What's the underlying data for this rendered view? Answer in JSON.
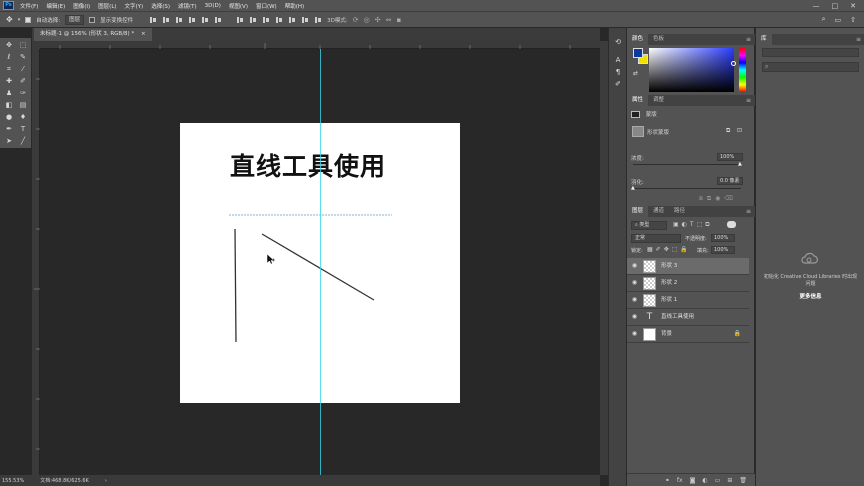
{
  "menubar": {
    "logo": "Ps",
    "items": [
      "文件(F)",
      "编辑(E)",
      "图像(I)",
      "图层(L)",
      "文字(Y)",
      "选择(S)",
      "滤镜(T)",
      "3D(D)",
      "视图(V)",
      "窗口(W)",
      "帮助(H)"
    ],
    "window_controls": [
      "—",
      "□",
      "✕"
    ]
  },
  "options": {
    "auto_select_label": "自动选择:",
    "auto_select_value": "图层",
    "transform_label": "显示变换控件"
  },
  "document": {
    "tab_title": "未标题-1 @ 156% (形状 3, RGB/8) *",
    "tab_close": "×",
    "artboard_title": "直线工具使用"
  },
  "status": {
    "zoom": "155.53%",
    "doc_size": "文档:468.8K/625.6K",
    "arrow": "›"
  },
  "color_panel": {
    "tabs": [
      "颜色",
      "色板"
    ],
    "foreground": "#0a3aa0",
    "background": "#f0e000"
  },
  "properties_panel": {
    "tabs": [
      "属性",
      "调整"
    ],
    "mask_label": "蒙版",
    "shape_mask_label": "形状蒙版",
    "density_label": "浓度:",
    "density_value": "100%",
    "feather_label": "羽化:",
    "feather_value": "0.0 像素"
  },
  "layers_panel": {
    "tabs": [
      "图层",
      "通道",
      "路径"
    ],
    "filter_kind": "类型",
    "blend_mode": "正常",
    "opacity_label": "不透明度:",
    "opacity_value": "100%",
    "lock_label": "锁定:",
    "fill_label": "填充:",
    "fill_value": "100%",
    "layers": [
      {
        "name": "形状 3",
        "type": "shape",
        "selected": true
      },
      {
        "name": "形状 2",
        "type": "shape",
        "selected": false
      },
      {
        "name": "形状 1",
        "type": "shape",
        "selected": false
      },
      {
        "name": "直线工具使用",
        "type": "text",
        "selected": false
      },
      {
        "name": "背景",
        "type": "background",
        "selected": false
      }
    ]
  },
  "libraries_panel": {
    "tab": "库",
    "message": "初始化 Creative Cloud Libraries 时出现问题",
    "update_label": "更多信息"
  },
  "colors": {
    "guide": "#35d4e6",
    "app_bg": "#282828",
    "panel_bg": "#535353"
  }
}
